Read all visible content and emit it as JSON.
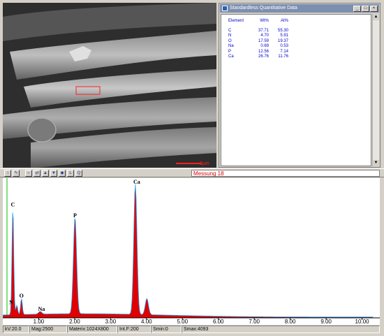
{
  "sem_image": {
    "scale_label": "2µm"
  },
  "quant_window": {
    "title": "Standardless Quantitative Data",
    "headers": [
      "Element",
      "Wt%",
      "At%"
    ],
    "rows": [
      {
        "element": "C",
        "wt": "37.71",
        "at": "55.30"
      },
      {
        "element": "N",
        "wt": "4.70",
        "at": "5.91"
      },
      {
        "element": "O",
        "wt": "17.59",
        "at": "19.37"
      },
      {
        "element": "Na",
        "wt": "0.69",
        "at": "0.53"
      },
      {
        "element": "P",
        "wt": "12.56",
        "at": "7.14"
      },
      {
        "element": "Ca",
        "wt": "26.76",
        "at": "11.76"
      }
    ]
  },
  "toolbar": {
    "icons": [
      "cursor-icon",
      "pointer-icon",
      "expand-icon",
      "compress-icon",
      "peak-icon",
      "ruler-icon",
      "marker-icon",
      "label-l-icon",
      "label-q-icon"
    ],
    "measurement_label": "Messung 18",
    "accent_color": "#e00000"
  },
  "spectrum": {
    "x_ticks": [
      "1.00",
      "2.00",
      "3.00",
      "4.00",
      "5.00",
      "6.00",
      "7.00",
      "8.00",
      "9.00",
      "10.00"
    ],
    "peak_labels": [
      "C",
      "N",
      "O",
      "Na",
      "P",
      "Ca"
    ],
    "fill_color": "#e00000",
    "outline_color": "#22aaff"
  },
  "chart_data": {
    "type": "area",
    "title": "",
    "xlabel": "",
    "ylabel": "",
    "xlim": [
      0,
      10.3
    ],
    "x_ticks": [
      1,
      2,
      3,
      4,
      5,
      6,
      7,
      8,
      9,
      10
    ],
    "peaks": [
      {
        "label": "C",
        "energy": 0.28,
        "rel_height": 0.8
      },
      {
        "label": "N",
        "energy": 0.39,
        "rel_height": 0.07
      },
      {
        "label": "O",
        "energy": 0.52,
        "rel_height": 0.12
      },
      {
        "label": "Na",
        "energy": 1.04,
        "rel_height": 0.02
      },
      {
        "label": "P",
        "energy": 2.01,
        "rel_height": 0.72
      },
      {
        "label": "Ca",
        "energy": 3.69,
        "rel_height": 0.97
      },
      {
        "label": "",
        "energy": 4.01,
        "rel_height": 0.12
      }
    ]
  },
  "status_bar": {
    "kv": "kV:20.0",
    "mag": "Mag:2500",
    "matrix": "Materix:1024X800",
    "int": "Int.F:200",
    "smin": "Smin:0",
    "smax": "Smax:4093"
  }
}
